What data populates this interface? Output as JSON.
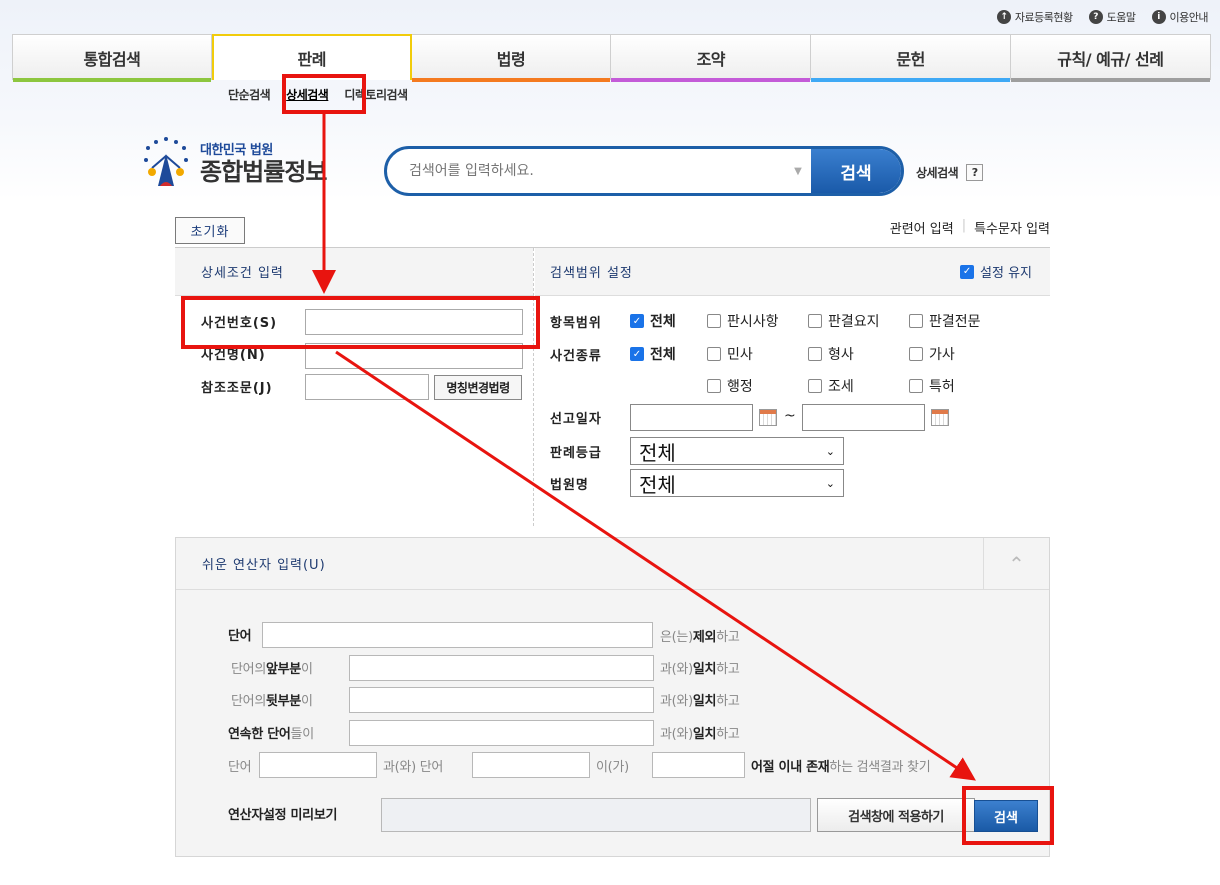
{
  "util_links": [
    {
      "label": "자료등록현황",
      "icon": "upload-icon"
    },
    {
      "label": "도움말",
      "icon": "question-icon"
    },
    {
      "label": "이용안내",
      "icon": "info-icon"
    }
  ],
  "main_tabs": [
    {
      "label": "통합검색",
      "color": "#8dc63f"
    },
    {
      "label": "판례",
      "color": "#f1cc0b"
    },
    {
      "label": "법령",
      "color": "#f47a20"
    },
    {
      "label": "조약",
      "color": "#c45bd8"
    },
    {
      "label": "문헌",
      "color": "#3fa9f5"
    },
    {
      "label": "규칙/ 예규/ 선례",
      "color": "#9e9e9e"
    }
  ],
  "sub_tabs": [
    "단순검색",
    "상세검색",
    "디렉토리검색"
  ],
  "logo": {
    "sub": "대한민국 법원",
    "main": "종합법률정보"
  },
  "search": {
    "placeholder": "검색어를 입력하세요.",
    "button": "검색",
    "advanced": "상세검색",
    "help": "?"
  },
  "toolbar": {
    "reset": "초기화",
    "related": "관련어 입력",
    "special": "특수문자 입력"
  },
  "detail": {
    "title": "상세조건 입력",
    "case_number": "사건번호(S)",
    "case_name": "사건명(N)",
    "reference": "참조조문(J)",
    "law_button": "명칭변경법령"
  },
  "scope": {
    "title": "검색범위 설정",
    "keep": "설정 유지",
    "item_label": "항목범위",
    "items": [
      "전체",
      "판시사항",
      "판결요지",
      "판결전문"
    ],
    "type_label": "사건종류",
    "types_row1": [
      "전체",
      "민사",
      "형사",
      "가사"
    ],
    "types_row2": [
      "행정",
      "조세",
      "특허"
    ],
    "date_label": "선고일자",
    "date_sep": "~",
    "grade_label": "판례등급",
    "grade_value": "전체",
    "court_label": "법원명",
    "court_value": "전체"
  },
  "ops": {
    "title": "쉬운 연산자 입력(U)",
    "r1_word": "단어",
    "r1_mid": "은(는) ",
    "r1_bold": "제외",
    "r1_end": "하고",
    "r2_pre": "단어의 ",
    "r2_bold": "앞부분",
    "r2_post": "이",
    "r3_bold": "뒷부분",
    "match_mid": "과(와) ",
    "match_bold": "일치",
    "r4_bold": "연속한 단어",
    "r4_post": "들이",
    "r5_word": "단어",
    "r5_and": "과(와) 단어",
    "r5_is": "이(가)",
    "r5_bold": "어절 이내 존재",
    "r5_end": "하는 검색결과 찾기",
    "preview_label": "연산자설정 미리보기",
    "apply": "검색창에 적용하기",
    "search": "검색"
  }
}
